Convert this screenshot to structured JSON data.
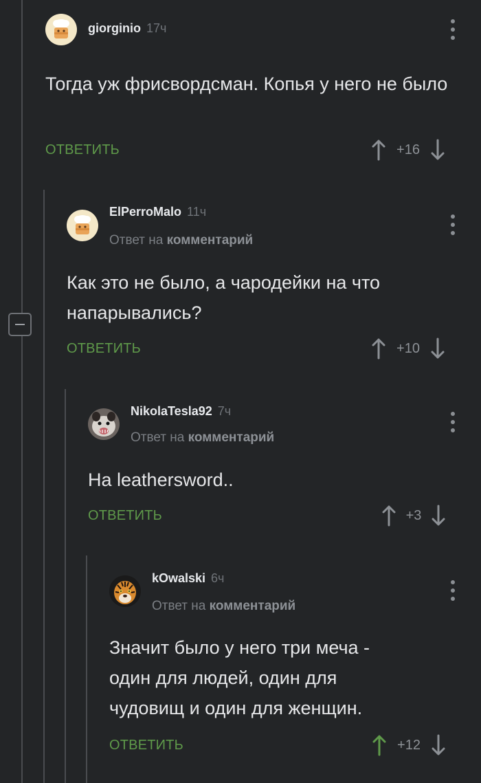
{
  "labels": {
    "reply_action": "ОТВЕТИТЬ",
    "reply_to_prefix": "Ответ на",
    "reply_to_target": "комментарий"
  },
  "comments": [
    {
      "username": "giorginio",
      "time": "17ч",
      "text": "Тогда уж фрисвордсман. Копья у него не было",
      "score": "+16",
      "avatar": "chef-hat-avatar",
      "upvoted": false
    },
    {
      "username": "ElPerroMalo",
      "time": "11ч",
      "text": "Как это не было, а чародейки на что напарывались?",
      "score": "+10",
      "avatar": "chef-hat-avatar",
      "upvoted": false
    },
    {
      "username": "NikolaTesla92",
      "time": "7ч",
      "text": "На leathersword..",
      "score": "+3",
      "avatar": "opossum-avatar",
      "upvoted": false
    },
    {
      "username": "kOwalski",
      "time": "6ч",
      "text": "Значит было у него три меча - один для людей, один для чудовищ и один для женщин.",
      "score": "+12",
      "avatar": "tiger-avatar",
      "upvoted": true
    }
  ],
  "colors": {
    "background": "#232527",
    "accent_green": "#5f9a4a",
    "upvoted_arrow": "#5f9a4a",
    "arrow_default": "#8d9196",
    "thread_line": "#4a4c50"
  },
  "icons": {
    "menu": "more-vertical-icon",
    "upvote": "arrow-up-icon",
    "downvote": "arrow-down-icon",
    "collapse": "minus-square-icon"
  }
}
